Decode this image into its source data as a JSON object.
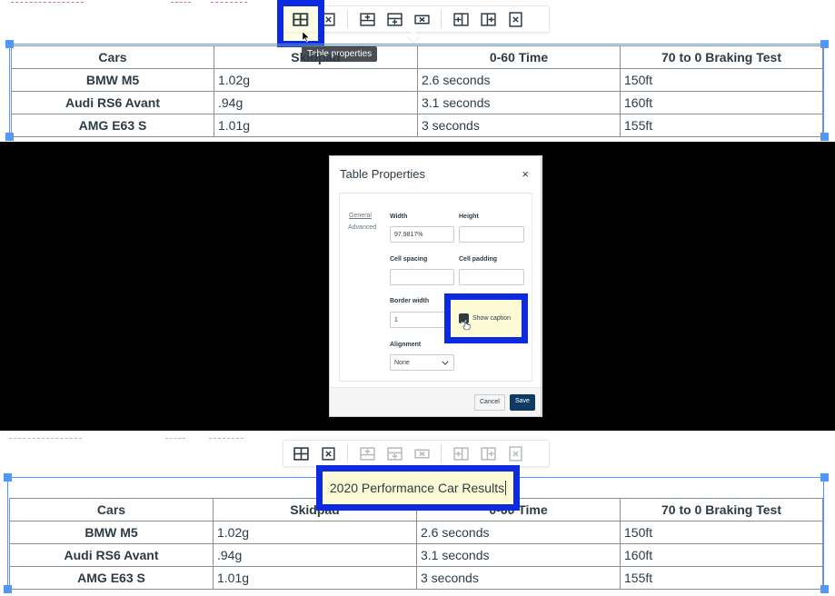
{
  "toolbar_top": {
    "buttons": [
      "table-properties-icon",
      "delete-table-icon",
      "insert-row-before-icon",
      "insert-row-after-icon",
      "delete-row-icon",
      "insert-column-before-icon",
      "insert-column-after-icon",
      "delete-column-icon"
    ],
    "tooltip": "Table properties"
  },
  "table": {
    "headers": [
      "Cars",
      "Skidpad",
      "0-60 Time",
      "70 to 0 Braking Test"
    ],
    "rows": [
      {
        "car": "BMW M5",
        "skidpad": "1.02g",
        "time": "2.6 seconds",
        "braking": "150ft"
      },
      {
        "car": "Audi RS6 Avant",
        "skidpad": ".94g",
        "time": "3.1 seconds",
        "braking": "160ft"
      },
      {
        "car": "AMG E63 S",
        "skidpad": "1.01g",
        "time": "3 seconds",
        "braking": "155ft"
      }
    ]
  },
  "dialog": {
    "title": "Table Properties",
    "close": "×",
    "tabs": [
      "General",
      "Advanced"
    ],
    "width_label": "Width",
    "width_value": "97.9817%",
    "height_label": "Height",
    "cell_spacing_label": "Cell spacing",
    "cell_padding_label": "Cell padding",
    "border_width_label": "Border width",
    "border_width_value": "1",
    "show_caption_label": "Show caption",
    "show_caption_checked": true,
    "alignment_label": "Alignment",
    "alignment_value": "None",
    "cancel_label": "Cancel",
    "save_label": "Save"
  },
  "caption": "2020 Performance Car Results",
  "colors": {
    "highlight_blue": "#0c2ae0",
    "selection_blue": "#4d97ff",
    "save_button": "#0d3b64"
  }
}
